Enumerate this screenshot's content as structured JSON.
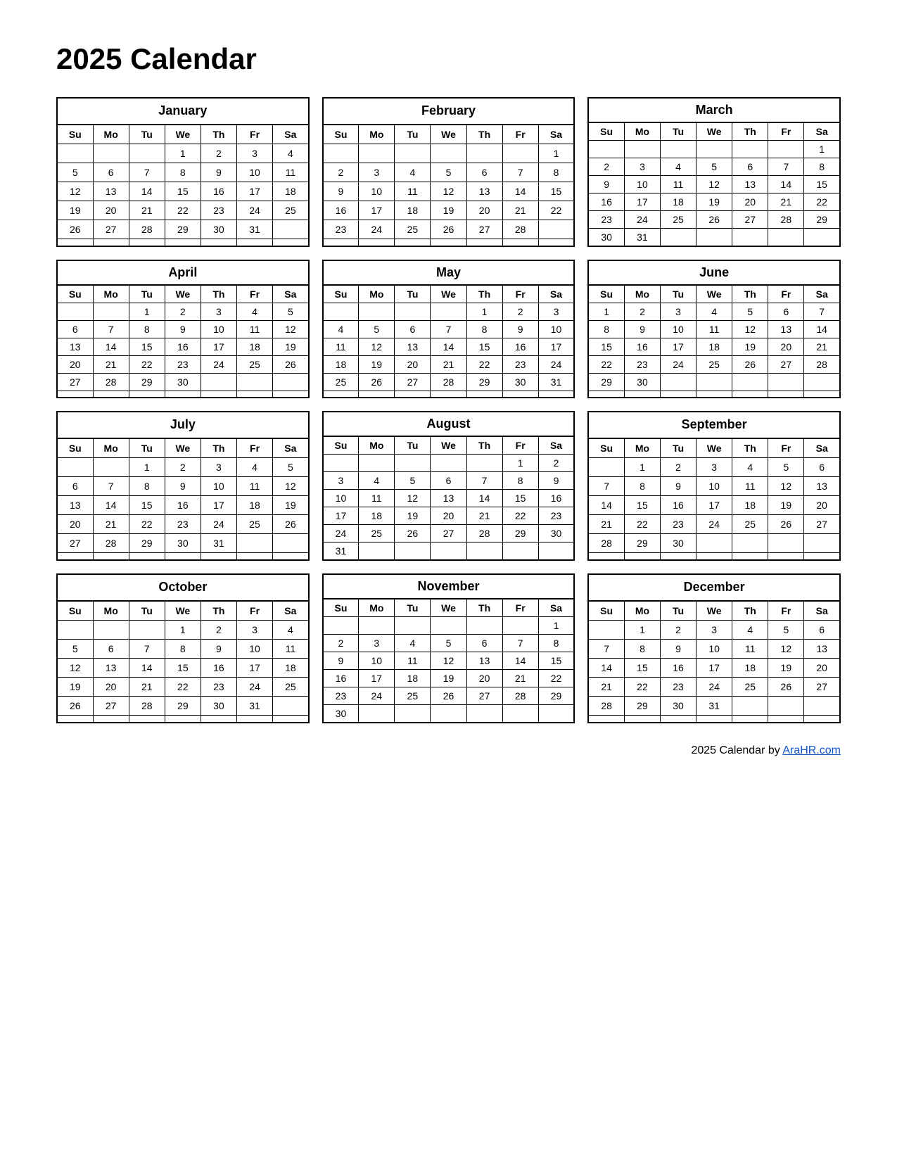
{
  "title": "2025 Calendar",
  "footer": {
    "text": "2025  Calendar by ",
    "link_label": "AraHR.com",
    "link_url": "https://AraHR.com"
  },
  "months": [
    {
      "name": "January",
      "days_header": [
        "Su",
        "Mo",
        "Tu",
        "We",
        "Th",
        "Fr",
        "Sa"
      ],
      "weeks": [
        [
          "",
          "",
          "",
          "1",
          "2",
          "3",
          "4"
        ],
        [
          "5",
          "6",
          "7",
          "8",
          "9",
          "10",
          "11"
        ],
        [
          "12",
          "13",
          "14",
          "15",
          "16",
          "17",
          "18"
        ],
        [
          "19",
          "20",
          "21",
          "22",
          "23",
          "24",
          "25"
        ],
        [
          "26",
          "27",
          "28",
          "29",
          "30",
          "31",
          ""
        ],
        [
          "",
          "",
          "",
          "",
          "",
          "",
          ""
        ]
      ]
    },
    {
      "name": "February",
      "days_header": [
        "Su",
        "Mo",
        "Tu",
        "We",
        "Th",
        "Fr",
        "Sa"
      ],
      "weeks": [
        [
          "",
          "",
          "",
          "",
          "",
          "",
          "1"
        ],
        [
          "2",
          "3",
          "4",
          "5",
          "6",
          "7",
          "8"
        ],
        [
          "9",
          "10",
          "11",
          "12",
          "13",
          "14",
          "15"
        ],
        [
          "16",
          "17",
          "18",
          "19",
          "20",
          "21",
          "22"
        ],
        [
          "23",
          "24",
          "25",
          "26",
          "27",
          "28",
          ""
        ],
        [
          "",
          "",
          "",
          "",
          "",
          "",
          ""
        ]
      ]
    },
    {
      "name": "March",
      "days_header": [
        "Su",
        "Mo",
        "Tu",
        "We",
        "Th",
        "Fr",
        "Sa"
      ],
      "weeks": [
        [
          "",
          "",
          "",
          "",
          "",
          "",
          "1"
        ],
        [
          "2",
          "3",
          "4",
          "5",
          "6",
          "7",
          "8"
        ],
        [
          "9",
          "10",
          "11",
          "12",
          "13",
          "14",
          "15"
        ],
        [
          "16",
          "17",
          "18",
          "19",
          "20",
          "21",
          "22"
        ],
        [
          "23",
          "24",
          "25",
          "26",
          "27",
          "28",
          "29"
        ],
        [
          "30",
          "31",
          "",
          "",
          "",
          "",
          ""
        ]
      ]
    },
    {
      "name": "April",
      "days_header": [
        "Su",
        "Mo",
        "Tu",
        "We",
        "Th",
        "Fr",
        "Sa"
      ],
      "weeks": [
        [
          "",
          "",
          "1",
          "2",
          "3",
          "4",
          "5"
        ],
        [
          "6",
          "7",
          "8",
          "9",
          "10",
          "11",
          "12"
        ],
        [
          "13",
          "14",
          "15",
          "16",
          "17",
          "18",
          "19"
        ],
        [
          "20",
          "21",
          "22",
          "23",
          "24",
          "25",
          "26"
        ],
        [
          "27",
          "28",
          "29",
          "30",
          "",
          "",
          ""
        ],
        [
          "",
          "",
          "",
          "",
          "",
          "",
          ""
        ]
      ]
    },
    {
      "name": "May",
      "days_header": [
        "Su",
        "Mo",
        "Tu",
        "We",
        "Th",
        "Fr",
        "Sa"
      ],
      "weeks": [
        [
          "",
          "",
          "",
          "",
          "1",
          "2",
          "3"
        ],
        [
          "4",
          "5",
          "6",
          "7",
          "8",
          "9",
          "10"
        ],
        [
          "11",
          "12",
          "13",
          "14",
          "15",
          "16",
          "17"
        ],
        [
          "18",
          "19",
          "20",
          "21",
          "22",
          "23",
          "24"
        ],
        [
          "25",
          "26",
          "27",
          "28",
          "29",
          "30",
          "31"
        ],
        [
          "",
          "",
          "",
          "",
          "",
          "",
          ""
        ]
      ]
    },
    {
      "name": "June",
      "days_header": [
        "Su",
        "Mo",
        "Tu",
        "We",
        "Th",
        "Fr",
        "Sa"
      ],
      "weeks": [
        [
          "1",
          "2",
          "3",
          "4",
          "5",
          "6",
          "7"
        ],
        [
          "8",
          "9",
          "10",
          "11",
          "12",
          "13",
          "14"
        ],
        [
          "15",
          "16",
          "17",
          "18",
          "19",
          "20",
          "21"
        ],
        [
          "22",
          "23",
          "24",
          "25",
          "26",
          "27",
          "28"
        ],
        [
          "29",
          "30",
          "",
          "",
          "",
          "",
          ""
        ],
        [
          "",
          "",
          "",
          "",
          "",
          "",
          ""
        ]
      ]
    },
    {
      "name": "July",
      "days_header": [
        "Su",
        "Mo",
        "Tu",
        "We",
        "Th",
        "Fr",
        "Sa"
      ],
      "weeks": [
        [
          "",
          "",
          "1",
          "2",
          "3",
          "4",
          "5"
        ],
        [
          "6",
          "7",
          "8",
          "9",
          "10",
          "11",
          "12"
        ],
        [
          "13",
          "14",
          "15",
          "16",
          "17",
          "18",
          "19"
        ],
        [
          "20",
          "21",
          "22",
          "23",
          "24",
          "25",
          "26"
        ],
        [
          "27",
          "28",
          "29",
          "30",
          "31",
          "",
          ""
        ],
        [
          "",
          "",
          "",
          "",
          "",
          "",
          ""
        ]
      ]
    },
    {
      "name": "August",
      "days_header": [
        "Su",
        "Mo",
        "Tu",
        "We",
        "Th",
        "Fr",
        "Sa"
      ],
      "weeks": [
        [
          "",
          "",
          "",
          "",
          "",
          "1",
          "2"
        ],
        [
          "3",
          "4",
          "5",
          "6",
          "7",
          "8",
          "9"
        ],
        [
          "10",
          "11",
          "12",
          "13",
          "14",
          "15",
          "16"
        ],
        [
          "17",
          "18",
          "19",
          "20",
          "21",
          "22",
          "23"
        ],
        [
          "24",
          "25",
          "26",
          "27",
          "28",
          "29",
          "30"
        ],
        [
          "31",
          "",
          "",
          "",
          "",
          "",
          ""
        ]
      ]
    },
    {
      "name": "September",
      "days_header": [
        "Su",
        "Mo",
        "Tu",
        "We",
        "Th",
        "Fr",
        "Sa"
      ],
      "weeks": [
        [
          "",
          "1",
          "2",
          "3",
          "4",
          "5",
          "6"
        ],
        [
          "7",
          "8",
          "9",
          "10",
          "11",
          "12",
          "13"
        ],
        [
          "14",
          "15",
          "16",
          "17",
          "18",
          "19",
          "20"
        ],
        [
          "21",
          "22",
          "23",
          "24",
          "25",
          "26",
          "27"
        ],
        [
          "28",
          "29",
          "30",
          "",
          "",
          "",
          ""
        ],
        [
          "",
          "",
          "",
          "",
          "",
          "",
          ""
        ]
      ]
    },
    {
      "name": "October",
      "days_header": [
        "Su",
        "Mo",
        "Tu",
        "We",
        "Th",
        "Fr",
        "Sa"
      ],
      "weeks": [
        [
          "",
          "",
          "",
          "1",
          "2",
          "3",
          "4"
        ],
        [
          "5",
          "6",
          "7",
          "8",
          "9",
          "10",
          "11"
        ],
        [
          "12",
          "13",
          "14",
          "15",
          "16",
          "17",
          "18"
        ],
        [
          "19",
          "20",
          "21",
          "22",
          "23",
          "24",
          "25"
        ],
        [
          "26",
          "27",
          "28",
          "29",
          "30",
          "31",
          ""
        ],
        [
          "",
          "",
          "",
          "",
          "",
          "",
          ""
        ]
      ]
    },
    {
      "name": "November",
      "days_header": [
        "Su",
        "Mo",
        "Tu",
        "We",
        "Th",
        "Fr",
        "Sa"
      ],
      "weeks": [
        [
          "",
          "",
          "",
          "",
          "",
          "",
          "1"
        ],
        [
          "2",
          "3",
          "4",
          "5",
          "6",
          "7",
          "8"
        ],
        [
          "9",
          "10",
          "11",
          "12",
          "13",
          "14",
          "15"
        ],
        [
          "16",
          "17",
          "18",
          "19",
          "20",
          "21",
          "22"
        ],
        [
          "23",
          "24",
          "25",
          "26",
          "27",
          "28",
          "29"
        ],
        [
          "30",
          "",
          "",
          "",
          "",
          "",
          ""
        ]
      ]
    },
    {
      "name": "December",
      "days_header": [
        "Su",
        "Mo",
        "Tu",
        "We",
        "Th",
        "Fr",
        "Sa"
      ],
      "weeks": [
        [
          "",
          "1",
          "2",
          "3",
          "4",
          "5",
          "6"
        ],
        [
          "7",
          "8",
          "9",
          "10",
          "11",
          "12",
          "13"
        ],
        [
          "14",
          "15",
          "16",
          "17",
          "18",
          "19",
          "20"
        ],
        [
          "21",
          "22",
          "23",
          "24",
          "25",
          "26",
          "27"
        ],
        [
          "28",
          "29",
          "30",
          "31",
          "",
          "",
          ""
        ],
        [
          "",
          "",
          "",
          "",
          "",
          "",
          ""
        ]
      ]
    }
  ]
}
